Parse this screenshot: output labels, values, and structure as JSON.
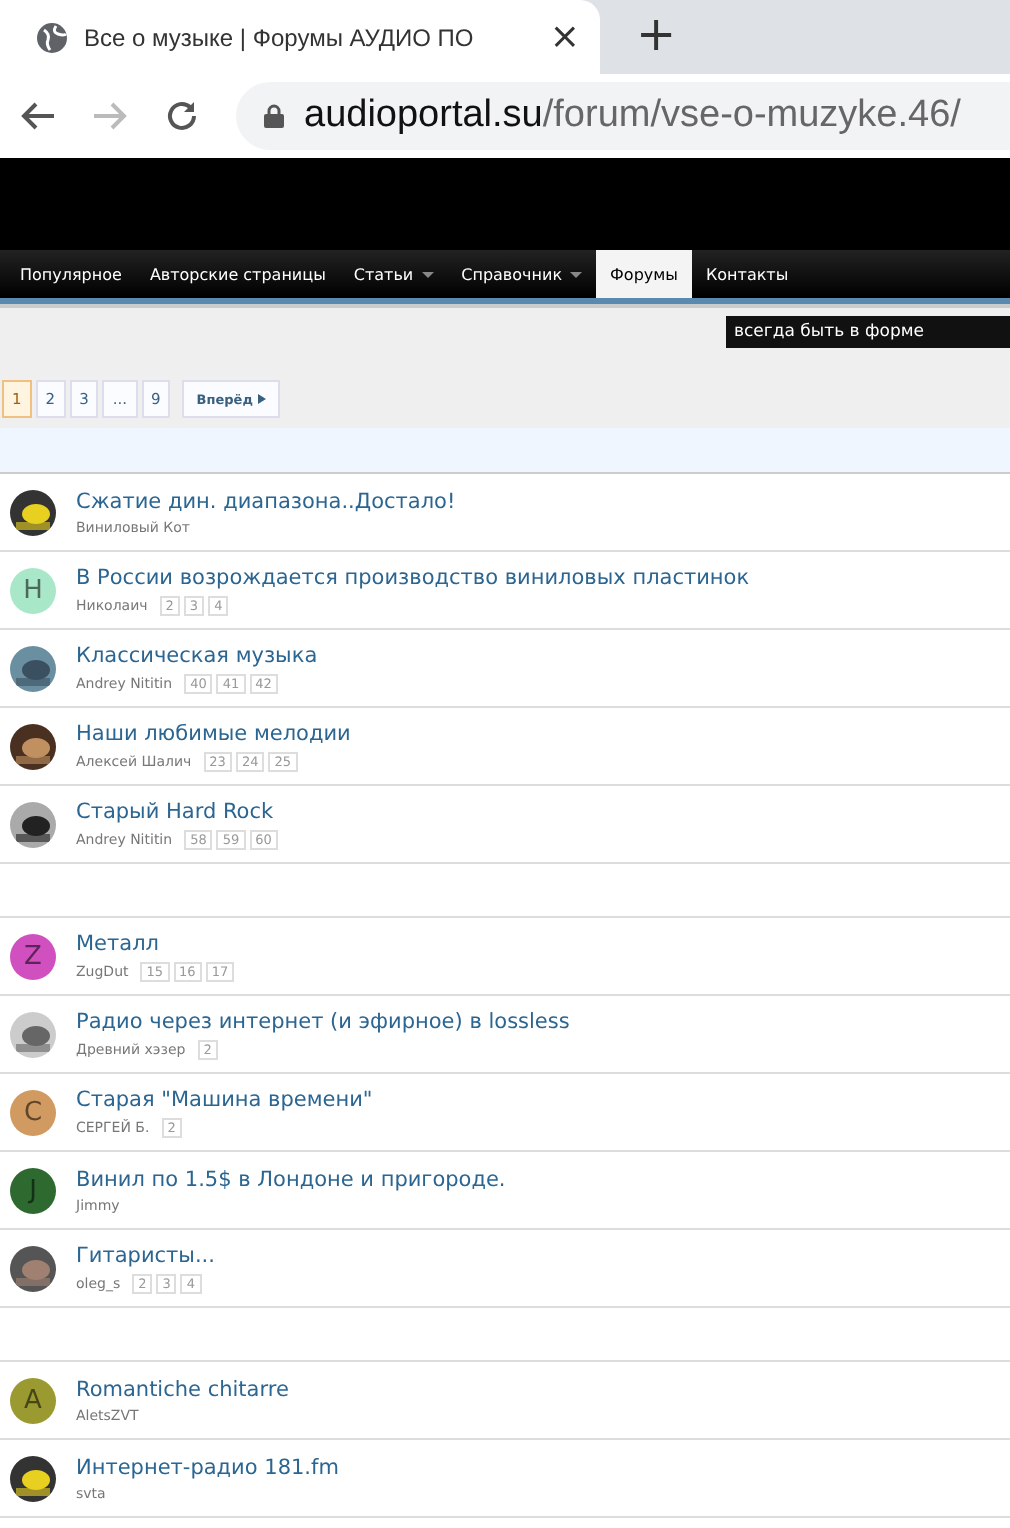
{
  "browser": {
    "tab_title": "Все о музыке | Форумы АУДИО ПО",
    "close": "×",
    "new_tab": "+",
    "url_host": "audioportal.su",
    "url_path": "/forum/vse-o-muzyke.46/"
  },
  "nav": [
    {
      "label": "Популярное",
      "selected": false,
      "dropdown": false
    },
    {
      "label": "Авторские страницы",
      "selected": false,
      "dropdown": false
    },
    {
      "label": "Статьи",
      "selected": false,
      "dropdown": true
    },
    {
      "label": "Справочник",
      "selected": false,
      "dropdown": true
    },
    {
      "label": "Форумы",
      "selected": true,
      "dropdown": false
    },
    {
      "label": "Контакты",
      "selected": false,
      "dropdown": false
    }
  ],
  "tooltip": "всегда быть в форме",
  "pagination": {
    "pages": [
      {
        "label": "1",
        "selected": true
      },
      {
        "label": "2",
        "selected": false
      },
      {
        "label": "3",
        "selected": false
      },
      {
        "label": "...",
        "selected": false
      },
      {
        "label": "9",
        "selected": false
      }
    ],
    "next": "Вперёд"
  },
  "groups": [
    [
      {
        "title": "Сжатие дин. диапазона..Достало!",
        "author": "Виниловый Кот",
        "avatar": {
          "kind": "picture"
        }
      },
      {
        "title": "В России возрождается производство виниловых пластинок",
        "author": "Николаич",
        "pages": [
          "2",
          "3",
          "4"
        ],
        "avatar": {
          "kind": "letter",
          "letter": "H",
          "color": "#a8e8c8"
        }
      },
      {
        "title": "Классическая музыка",
        "author": "Andrey Nititin",
        "pages": [
          "40",
          "41",
          "42"
        ],
        "avatar": {
          "kind": "picture"
        }
      },
      {
        "title": "Наши любимые мелодии",
        "author": "Алексей Шалич",
        "pages": [
          "23",
          "24",
          "25"
        ],
        "avatar": {
          "kind": "picture"
        }
      },
      {
        "title": "Старый Hard Rock",
        "author": "Andrey Nititin",
        "pages": [
          "58",
          "59",
          "60"
        ],
        "avatar": {
          "kind": "picture"
        }
      }
    ],
    [
      {
        "title": "Металл",
        "author": "ZugDut",
        "pages": [
          "15",
          "16",
          "17"
        ],
        "avatar": {
          "kind": "letter",
          "letter": "Z",
          "color": "#d050c0"
        }
      },
      {
        "title": "Радио через интернет (и эфирное) в lossless",
        "author": "Древний хэзер",
        "pages": [
          "2"
        ],
        "avatar": {
          "kind": "picture"
        }
      },
      {
        "title": "Старая \"Машина времени\"",
        "author": "СЕРГЕЙ Б.",
        "pages": [
          "2"
        ],
        "avatar": {
          "kind": "letter",
          "letter": "C",
          "color": "#d09a60"
        }
      },
      {
        "title": "Винил по 1.5$ в Лондоне и пригороде.",
        "author": "Jimmy",
        "avatar": {
          "kind": "letter",
          "letter": "J",
          "color": "#2e6a30"
        }
      },
      {
        "title": "Гитаристы...",
        "author": "oleg_s",
        "pages": [
          "2",
          "3",
          "4"
        ],
        "avatar": {
          "kind": "picture"
        }
      }
    ],
    [
      {
        "title": "Romantiche chitarre",
        "author": "AletsZVT",
        "avatar": {
          "kind": "letter",
          "letter": "A",
          "color": "#9a9a30"
        }
      },
      {
        "title": "Интернет-радио 181.fm",
        "author": "svta",
        "avatar": {
          "kind": "picture"
        }
      }
    ]
  ]
}
